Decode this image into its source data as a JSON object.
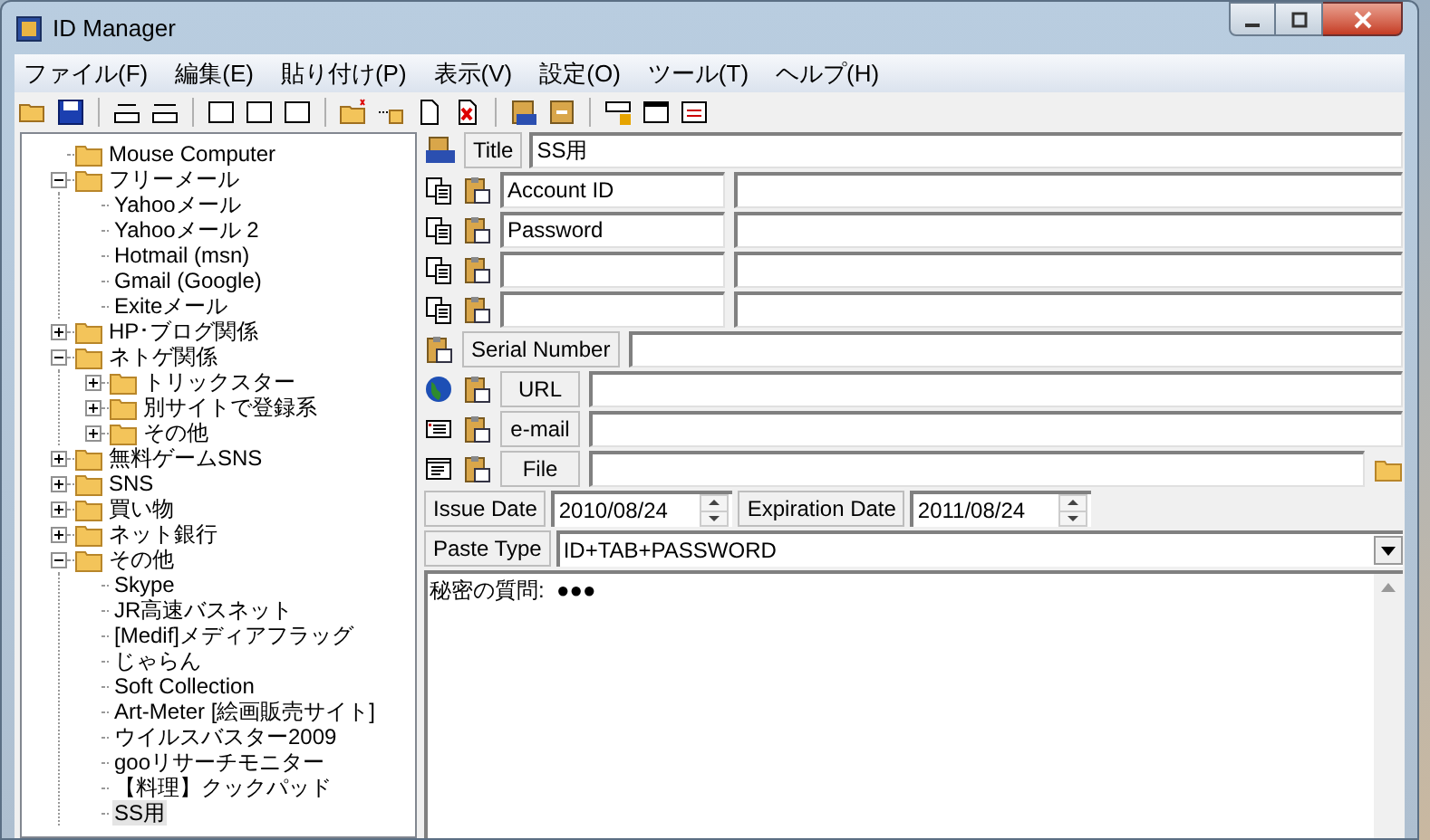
{
  "window": {
    "title": "ID Manager"
  },
  "menu": [
    "ファイル(F)",
    "編集(E)",
    "貼り付け(P)",
    "表示(V)",
    "設定(O)",
    "ツール(T)",
    "ヘルプ(H)"
  ],
  "tree": [
    {
      "kind": "entry",
      "label": "Mouse Computer",
      "selected": false
    },
    {
      "kind": "folder",
      "label": "フリーメール",
      "expanded": true,
      "selected": false,
      "children": [
        {
          "kind": "entry",
          "label": "Yahooメール",
          "selected": false
        },
        {
          "kind": "entry",
          "label": "Yahooメール 2",
          "selected": false
        },
        {
          "kind": "entry",
          "label": "Hotmail (msn)",
          "selected": false
        },
        {
          "kind": "entry",
          "label": "Gmail (Google)",
          "selected": false
        },
        {
          "kind": "entry",
          "label": "Exiteメール",
          "selected": false
        }
      ]
    },
    {
      "kind": "folder",
      "label": "HP･ブログ関係",
      "expanded": false,
      "selected": false
    },
    {
      "kind": "folder",
      "label": "ネトゲ関係",
      "expanded": true,
      "selected": false,
      "children": [
        {
          "kind": "folder",
          "label": "トリックスター",
          "expanded": false,
          "selected": false
        },
        {
          "kind": "folder",
          "label": "別サイトで登録系",
          "expanded": false,
          "selected": false
        },
        {
          "kind": "folder",
          "label": "その他",
          "expanded": false,
          "selected": false
        }
      ]
    },
    {
      "kind": "folder",
      "label": "無料ゲームSNS",
      "expanded": false,
      "selected": false
    },
    {
      "kind": "folder",
      "label": "SNS",
      "expanded": false,
      "selected": false
    },
    {
      "kind": "folder",
      "label": "買い物",
      "expanded": false,
      "selected": false
    },
    {
      "kind": "folder",
      "label": "ネット銀行",
      "expanded": false,
      "selected": false
    },
    {
      "kind": "folder",
      "label": "その他",
      "expanded": true,
      "selected": false,
      "children": [
        {
          "kind": "entry",
          "label": "Skype",
          "selected": false
        },
        {
          "kind": "entry",
          "label": "JR高速バスネット",
          "selected": false
        },
        {
          "kind": "entry",
          "label": "[Medif]メディアフラッグ",
          "selected": false
        },
        {
          "kind": "entry",
          "label": "じゃらん",
          "selected": false
        },
        {
          "kind": "entry",
          "label": "Soft Collection",
          "selected": false
        },
        {
          "kind": "entry",
          "label": "Art-Meter [絵画販売サイト]",
          "selected": false
        },
        {
          "kind": "entry",
          "label": "ウイルスバスター2009",
          "selected": false
        },
        {
          "kind": "entry",
          "label": "gooリサーチモニター",
          "selected": false
        },
        {
          "kind": "entry",
          "label": "【料理】クックパッド",
          "selected": false
        },
        {
          "kind": "entry",
          "label": "SS用",
          "selected": true
        }
      ]
    }
  ],
  "title_field": {
    "label": "Title",
    "value": "SS用"
  },
  "pairs": [
    {
      "kind": "named",
      "name": "Account ID"
    },
    {
      "kind": "named",
      "name": "Password"
    },
    {
      "kind": "blank"
    },
    {
      "kind": "blank"
    }
  ],
  "links": [
    {
      "kind": "serial",
      "label": "Serial Number"
    },
    {
      "kind": "url",
      "label": "URL"
    },
    {
      "kind": "email",
      "label": "e-mail"
    },
    {
      "kind": "file",
      "label": "File"
    }
  ],
  "dates": [
    {
      "label": "Issue Date",
      "value": "2010/08/24"
    },
    {
      "label": "Expiration Date",
      "value": "2011/08/24"
    }
  ],
  "paste_type": {
    "label": "Paste Type",
    "value": "ID+TAB+PASSWORD"
  },
  "notes": "秘密の質問:  ●●●"
}
